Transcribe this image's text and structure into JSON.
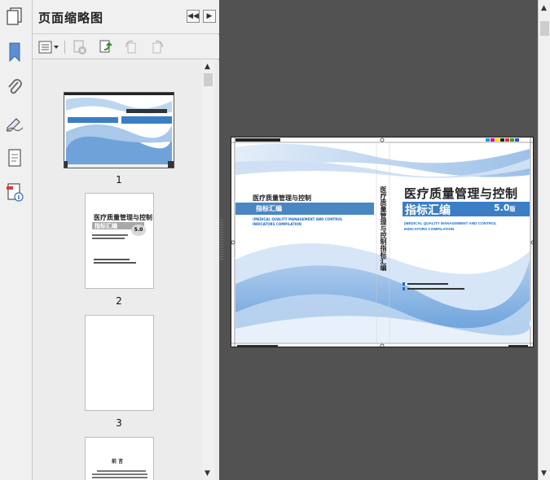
{
  "panel": {
    "title": "页面缩略图"
  },
  "thumbnails": [
    {
      "page_label": "1"
    },
    {
      "page_label": "2"
    },
    {
      "page_label": "3"
    }
  ],
  "cover": {
    "title_main": "医疗质量管理与控制",
    "subtitle": "指标汇编",
    "version": "5.0",
    "version_suffix": "版",
    "english_line1": "(MEDICAL QUALITY MANAGEMENT AND CONTROL",
    "english_line2": "INDICATORS COMPILATION",
    "spine_text": "医疗质量管理与控制指标汇编",
    "thumb2_title": "医疗质量管理与控制",
    "thumb2_subtitle": "指标汇编",
    "thumb2_version": "5.0",
    "preface_title": "前 言"
  },
  "colors": {
    "accent_blue": "#3b7ec6",
    "band_blue": "#4a86c2",
    "panel_bg": "#f0f0f0",
    "doc_bg": "#525252"
  }
}
